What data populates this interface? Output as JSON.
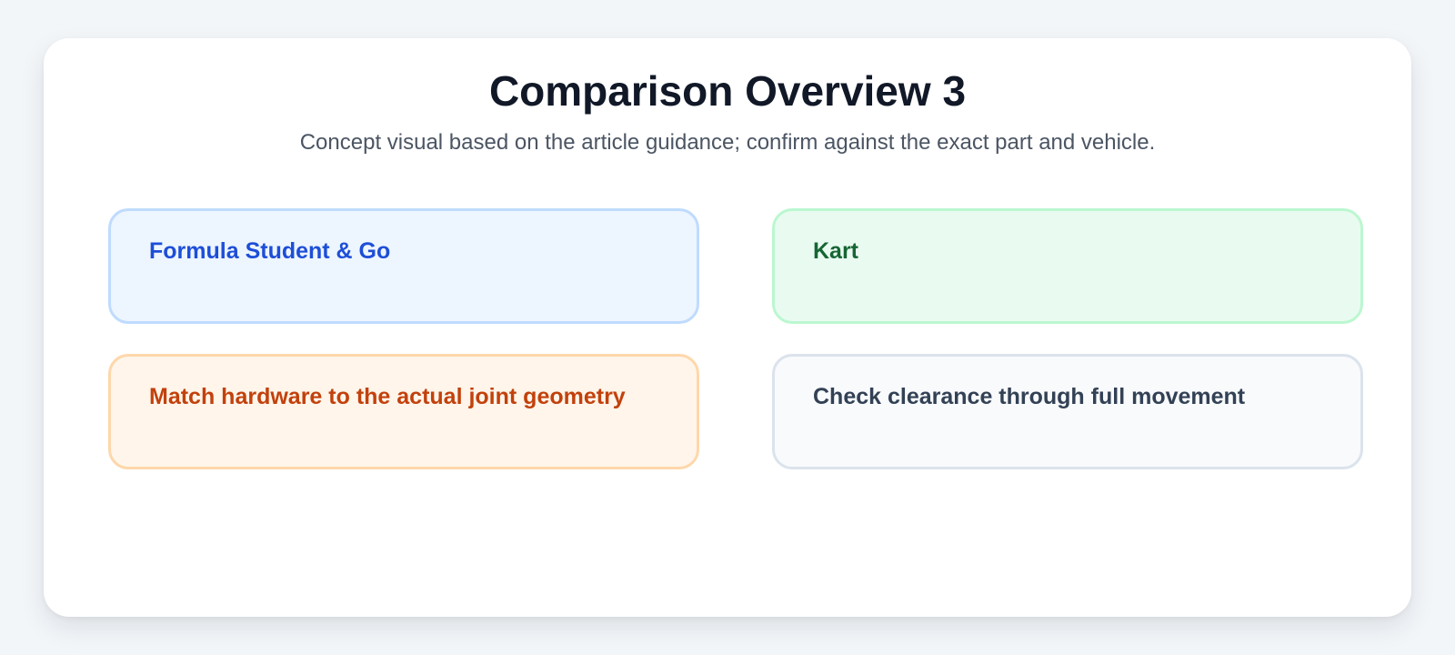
{
  "header": {
    "title": "Comparison Overview 3",
    "subtitle": "Concept visual based on the article guidance; confirm against the exact part and vehicle."
  },
  "boxes": [
    {
      "label": "Formula Student & Go",
      "bg": "#edf5fe",
      "border": "#bfdbfe",
      "text_color": "#1d4ed8"
    },
    {
      "label": "Kart",
      "bg": "#e9fbf1",
      "border": "#bbf7d0",
      "text_color": "#166534"
    },
    {
      "label": "Match hardware to the actual joint geometry",
      "bg": "#fff5ea",
      "border": "#fed7aa",
      "text_color": "#c2410c"
    },
    {
      "label": "Check clearance through full movement",
      "bg": "#f8fafc",
      "border": "#dbe3ec",
      "text_color": "#334155"
    }
  ]
}
